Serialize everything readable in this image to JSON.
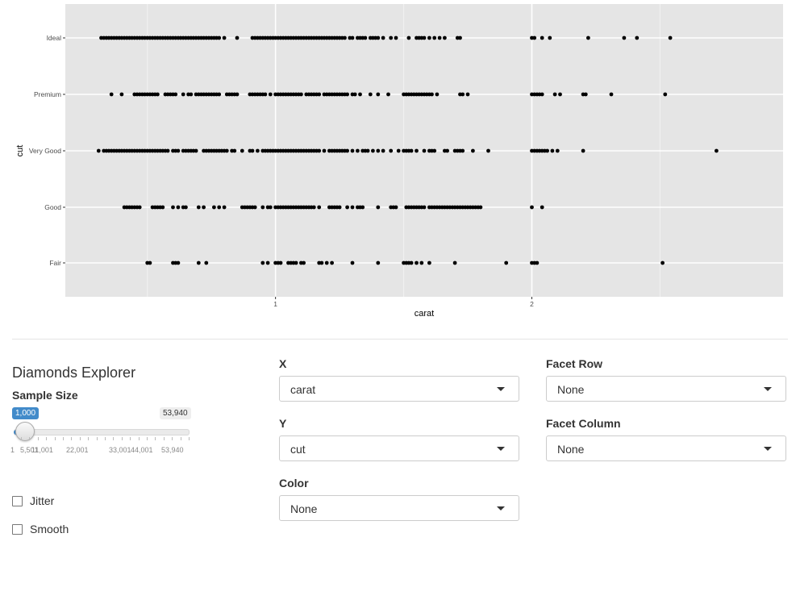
{
  "chart_data": {
    "type": "scatter",
    "xlabel": "carat",
    "ylabel": "cut",
    "x_ticks": [
      1,
      2
    ],
    "xlim": [
      0.18,
      2.98
    ],
    "categories": [
      "Fair",
      "Good",
      "Very Good",
      "Premium",
      "Ideal"
    ],
    "grid": true,
    "series": [
      {
        "category": "Ideal",
        "x": [
          0.32,
          0.33,
          0.34,
          0.35,
          0.36,
          0.37,
          0.38,
          0.39,
          0.4,
          0.41,
          0.42,
          0.43,
          0.44,
          0.45,
          0.46,
          0.47,
          0.48,
          0.49,
          0.5,
          0.51,
          0.52,
          0.53,
          0.54,
          0.55,
          0.56,
          0.57,
          0.58,
          0.59,
          0.6,
          0.61,
          0.62,
          0.63,
          0.64,
          0.65,
          0.66,
          0.67,
          0.68,
          0.69,
          0.7,
          0.71,
          0.72,
          0.73,
          0.74,
          0.75,
          0.76,
          0.77,
          0.78,
          0.8,
          0.85,
          0.91,
          0.92,
          0.93,
          0.94,
          0.95,
          0.96,
          0.97,
          0.98,
          0.99,
          1.0,
          1.01,
          1.02,
          1.03,
          1.04,
          1.05,
          1.06,
          1.07,
          1.08,
          1.09,
          1.1,
          1.11,
          1.12,
          1.13,
          1.14,
          1.15,
          1.16,
          1.17,
          1.18,
          1.19,
          1.2,
          1.21,
          1.22,
          1.23,
          1.24,
          1.25,
          1.26,
          1.27,
          1.29,
          1.3,
          1.32,
          1.33,
          1.34,
          1.35,
          1.37,
          1.38,
          1.39,
          1.4,
          1.42,
          1.45,
          1.47,
          1.52,
          1.55,
          1.56,
          1.57,
          1.58,
          1.6,
          1.62,
          1.64,
          1.66,
          1.71,
          1.72,
          2.0,
          2.01,
          2.04,
          2.07,
          2.22,
          2.36,
          2.41,
          2.54
        ]
      },
      {
        "category": "Premium",
        "x": [
          0.36,
          0.4,
          0.45,
          0.46,
          0.47,
          0.48,
          0.49,
          0.5,
          0.51,
          0.52,
          0.53,
          0.54,
          0.57,
          0.58,
          0.59,
          0.6,
          0.61,
          0.64,
          0.66,
          0.67,
          0.69,
          0.7,
          0.71,
          0.72,
          0.73,
          0.74,
          0.75,
          0.76,
          0.77,
          0.78,
          0.81,
          0.82,
          0.83,
          0.84,
          0.85,
          0.9,
          0.91,
          0.92,
          0.93,
          0.94,
          0.95,
          0.96,
          0.98,
          1.0,
          1.01,
          1.02,
          1.03,
          1.04,
          1.05,
          1.06,
          1.07,
          1.08,
          1.09,
          1.1,
          1.12,
          1.13,
          1.14,
          1.15,
          1.16,
          1.17,
          1.19,
          1.2,
          1.21,
          1.22,
          1.23,
          1.24,
          1.25,
          1.26,
          1.27,
          1.28,
          1.3,
          1.31,
          1.33,
          1.37,
          1.4,
          1.44,
          1.5,
          1.51,
          1.52,
          1.53,
          1.54,
          1.55,
          1.56,
          1.57,
          1.58,
          1.59,
          1.6,
          1.61,
          1.63,
          1.72,
          1.73,
          1.75,
          2.0,
          2.01,
          2.02,
          2.03,
          2.04,
          2.09,
          2.11,
          2.2,
          2.21,
          2.31,
          2.52
        ]
      },
      {
        "category": "Very Good",
        "x": [
          0.31,
          0.33,
          0.34,
          0.35,
          0.36,
          0.37,
          0.38,
          0.39,
          0.4,
          0.41,
          0.42,
          0.43,
          0.44,
          0.45,
          0.46,
          0.47,
          0.48,
          0.49,
          0.5,
          0.51,
          0.52,
          0.53,
          0.54,
          0.55,
          0.56,
          0.57,
          0.58,
          0.6,
          0.61,
          0.62,
          0.64,
          0.65,
          0.66,
          0.67,
          0.68,
          0.69,
          0.72,
          0.73,
          0.74,
          0.75,
          0.76,
          0.77,
          0.78,
          0.79,
          0.8,
          0.81,
          0.83,
          0.84,
          0.87,
          0.9,
          0.91,
          0.93,
          0.95,
          0.96,
          0.97,
          0.98,
          0.99,
          1.0,
          1.01,
          1.02,
          1.03,
          1.04,
          1.05,
          1.06,
          1.07,
          1.08,
          1.09,
          1.1,
          1.11,
          1.12,
          1.13,
          1.14,
          1.15,
          1.16,
          1.17,
          1.19,
          1.21,
          1.22,
          1.23,
          1.24,
          1.25,
          1.26,
          1.27,
          1.28,
          1.3,
          1.32,
          1.34,
          1.35,
          1.36,
          1.38,
          1.4,
          1.42,
          1.45,
          1.48,
          1.5,
          1.51,
          1.52,
          1.53,
          1.55,
          1.58,
          1.6,
          1.61,
          1.62,
          1.66,
          1.67,
          1.7,
          1.71,
          1.72,
          1.73,
          1.77,
          1.83,
          2.0,
          2.01,
          2.02,
          2.03,
          2.04,
          2.05,
          2.06,
          2.08,
          2.1,
          2.2,
          2.72
        ]
      },
      {
        "category": "Good",
        "x": [
          0.41,
          0.42,
          0.43,
          0.44,
          0.45,
          0.46,
          0.47,
          0.52,
          0.53,
          0.54,
          0.55,
          0.56,
          0.6,
          0.62,
          0.64,
          0.65,
          0.7,
          0.72,
          0.76,
          0.78,
          0.8,
          0.87,
          0.88,
          0.89,
          0.9,
          0.91,
          0.92,
          0.95,
          0.97,
          0.98,
          1.0,
          1.01,
          1.02,
          1.03,
          1.04,
          1.05,
          1.06,
          1.07,
          1.08,
          1.09,
          1.1,
          1.11,
          1.12,
          1.13,
          1.14,
          1.15,
          1.17,
          1.21,
          1.22,
          1.23,
          1.24,
          1.25,
          1.28,
          1.3,
          1.32,
          1.33,
          1.34,
          1.4,
          1.45,
          1.46,
          1.47,
          1.51,
          1.52,
          1.53,
          1.54,
          1.55,
          1.56,
          1.57,
          1.58,
          1.6,
          1.61,
          1.62,
          1.63,
          1.64,
          1.65,
          1.66,
          1.67,
          1.68,
          1.69,
          1.7,
          1.71,
          1.72,
          1.73,
          1.74,
          1.75,
          1.76,
          1.77,
          1.78,
          1.79,
          1.8,
          2.0,
          2.04
        ]
      },
      {
        "category": "Fair",
        "x": [
          0.5,
          0.51,
          0.6,
          0.61,
          0.62,
          0.7,
          0.73,
          0.95,
          0.97,
          1.0,
          1.01,
          1.02,
          1.05,
          1.06,
          1.07,
          1.08,
          1.1,
          1.11,
          1.17,
          1.18,
          1.2,
          1.22,
          1.3,
          1.4,
          1.5,
          1.51,
          1.52,
          1.53,
          1.55,
          1.57,
          1.6,
          1.7,
          1.9,
          2.0,
          2.01,
          2.02,
          2.51
        ]
      }
    ]
  },
  "panel": {
    "title": "Diamonds Explorer",
    "sample_size": {
      "label": "Sample Size",
      "value": "1,000",
      "max_display": "53,940",
      "value_num": 1000,
      "min": 1,
      "max": 53940,
      "ticks": [
        "1",
        "5,501",
        "11,001",
        "22,001",
        "33,001",
        "44,001",
        "53,940"
      ]
    },
    "jitter": {
      "label": "Jitter",
      "checked": false
    },
    "smooth": {
      "label": "Smooth",
      "checked": false
    }
  },
  "controls": {
    "x": {
      "label": "X",
      "value": "carat"
    },
    "y": {
      "label": "Y",
      "value": "cut"
    },
    "color": {
      "label": "Color",
      "value": "None"
    },
    "facet_row": {
      "label": "Facet Row",
      "value": "None"
    },
    "facet_col": {
      "label": "Facet Column",
      "value": "None"
    }
  },
  "colors": {
    "panel_bg": "#e5e5e5",
    "grid": "#ffffff",
    "point": "#000000",
    "accent": "#428bca"
  }
}
